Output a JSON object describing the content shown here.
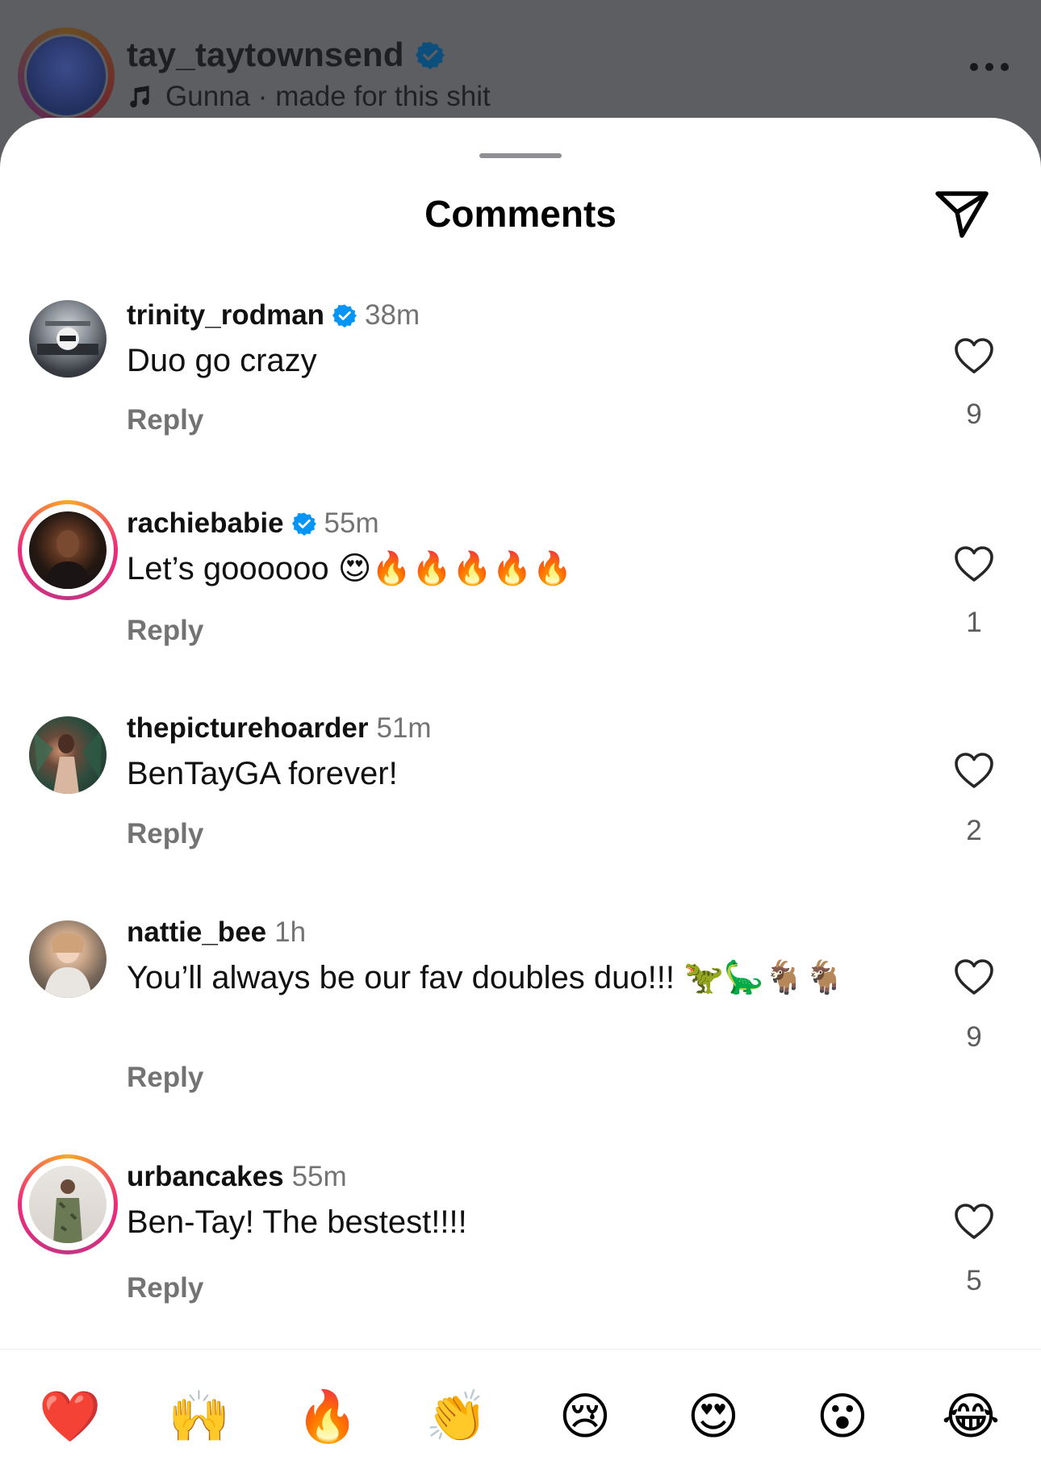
{
  "reel": {
    "username": "tay_taytownsend",
    "music": "Gunna · made for this shit"
  },
  "sheet": {
    "title": "Comments"
  },
  "comments": [
    {
      "username": "trinity_rodman",
      "verified": true,
      "time": "38m",
      "text": "Duo go crazy",
      "reply_label": "Reply",
      "likes": "9",
      "story_ring": false
    },
    {
      "username": "rachiebabie",
      "verified": true,
      "time": "55m",
      "text": "Let’s goooooo 😍🔥🔥🔥🔥🔥",
      "reply_label": "Reply",
      "likes": "1",
      "story_ring": true
    },
    {
      "username": "thepicturehoarder",
      "verified": false,
      "time": "51m",
      "text": "BenTayGA forever!",
      "reply_label": "Reply",
      "likes": "2",
      "story_ring": false
    },
    {
      "username": "nattie_bee",
      "verified": false,
      "time": "1h",
      "text": "You’ll always be our fav doubles duo!!! 🦖🦕🐐🐐",
      "reply_label": "Reply",
      "likes": "9",
      "story_ring": false
    },
    {
      "username": "urbancakes",
      "verified": false,
      "time": "55m",
      "text": "Ben-Tay! The bestest!!!!",
      "reply_label": "Reply",
      "likes": "5",
      "story_ring": true
    }
  ],
  "reactions": [
    "❤️",
    "🙌",
    "🔥",
    "👏",
    "😢",
    "😍",
    "😮",
    "😂"
  ],
  "colors": {
    "verified_blue": "#0095f6",
    "muted_text": "#737373",
    "story_ring": [
      "#f9a826",
      "#ee2a7b",
      "#c13584"
    ]
  }
}
